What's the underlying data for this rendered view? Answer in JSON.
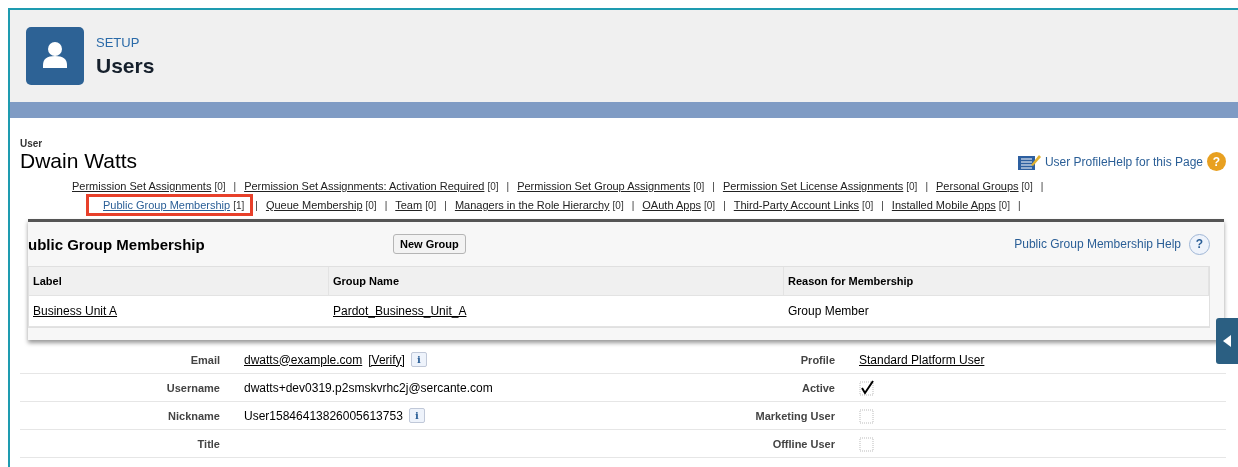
{
  "header": {
    "section": "SETUP",
    "title": "Users"
  },
  "user": {
    "label": "User",
    "name": "Dwain Watts"
  },
  "page_help": "User ProfileHelp for this Page",
  "page_help_icon": "?",
  "separator": "|",
  "related_links": [
    [
      {
        "label": "Permission Set Assignments",
        "count": "[0]",
        "selected": false
      },
      {
        "label": "Permission Set Assignments: Activation Required",
        "count": "[0]",
        "selected": false
      },
      {
        "label": "Permission Set Group Assignments",
        "count": "[0]",
        "selected": false
      },
      {
        "label": "Permission Set License Assignments",
        "count": "[0]",
        "selected": false
      },
      {
        "label": "Personal Groups",
        "count": "[0]",
        "selected": false
      }
    ],
    [
      {
        "label": "Public Group Membership",
        "count": "[1]",
        "selected": true
      },
      {
        "label": "Queue Membership",
        "count": "[0]",
        "selected": false
      },
      {
        "label": "Team",
        "count": "[0]",
        "selected": false
      },
      {
        "label": "Managers in the Role Hierarchy",
        "count": "[0]",
        "selected": false
      },
      {
        "label": "OAuth Apps",
        "count": "[0]",
        "selected": false
      },
      {
        "label": "Third-Party Account Links",
        "count": "[0]",
        "selected": false
      },
      {
        "label": "Installed Mobile Apps",
        "count": "[0]",
        "selected": false
      }
    ]
  ],
  "popup": {
    "title": "ublic Group Membership",
    "button": "New Group",
    "help": "Public Group Membership Help",
    "help_icon": "?",
    "columns": [
      "Label",
      "Group Name",
      "Reason for Membership"
    ],
    "rows": [
      {
        "label": "Business Unit A",
        "group_name": "Pardot_Business_Unit_A",
        "reason": "Group Member"
      }
    ]
  },
  "details": [
    {
      "left": {
        "label": "Email",
        "kind": "link",
        "value": "dwatts@example.com",
        "verify": "[Verify]",
        "info": "i"
      },
      "right": {
        "label": "Profile",
        "kind": "link",
        "value": "Standard Platform User"
      }
    },
    {
      "left": {
        "label": "Username",
        "kind": "text",
        "value": "dwatts+dev0319.p2smskvrhc2j@sercante.com"
      },
      "right": {
        "label": "Active",
        "kind": "checkbox",
        "checked": true
      }
    },
    {
      "left": {
        "label": "Nickname",
        "kind": "text",
        "value": "User15846413826005613753",
        "info": "i"
      },
      "right": {
        "label": "Marketing User",
        "kind": "checkbox",
        "checked": false
      }
    },
    {
      "left": {
        "label": "Title",
        "kind": "text"
      },
      "right": {
        "label": "Offline User",
        "kind": "checkbox",
        "checked": false
      }
    }
  ]
}
